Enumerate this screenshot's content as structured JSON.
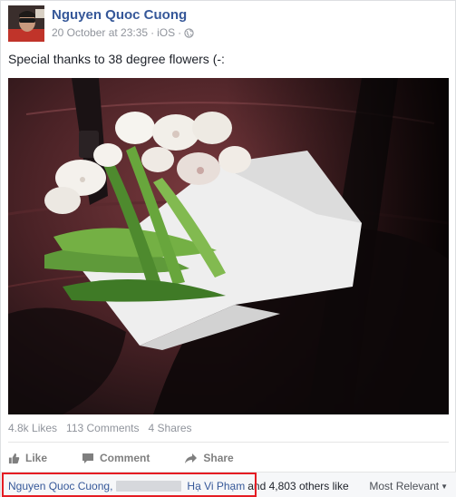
{
  "post": {
    "author": "Nguyen Quoc Cuong",
    "date": "20 October at 23:35",
    "separator": "·",
    "platform": "iOS",
    "privacy_icon": "globe-icon",
    "text": "Special thanks to 38 degree flowers (-:"
  },
  "photo": {
    "subject": "bouquet-on-car-seat"
  },
  "stats": {
    "likes": "4.8k Likes",
    "comments": "113 Comments",
    "shares": "4 Shares"
  },
  "actions": {
    "like": "Like",
    "comment": "Comment",
    "share": "Share"
  },
  "likes_summary": {
    "name1": "Nguyen Quoc Cuong,",
    "name2": "Hạ Vi Phạm",
    "rest": "and 4,803 others like",
    "sort": "Most Relevant"
  },
  "colors": {
    "link": "#365899",
    "meta": "#90949c",
    "highlight": "#e51c23"
  }
}
